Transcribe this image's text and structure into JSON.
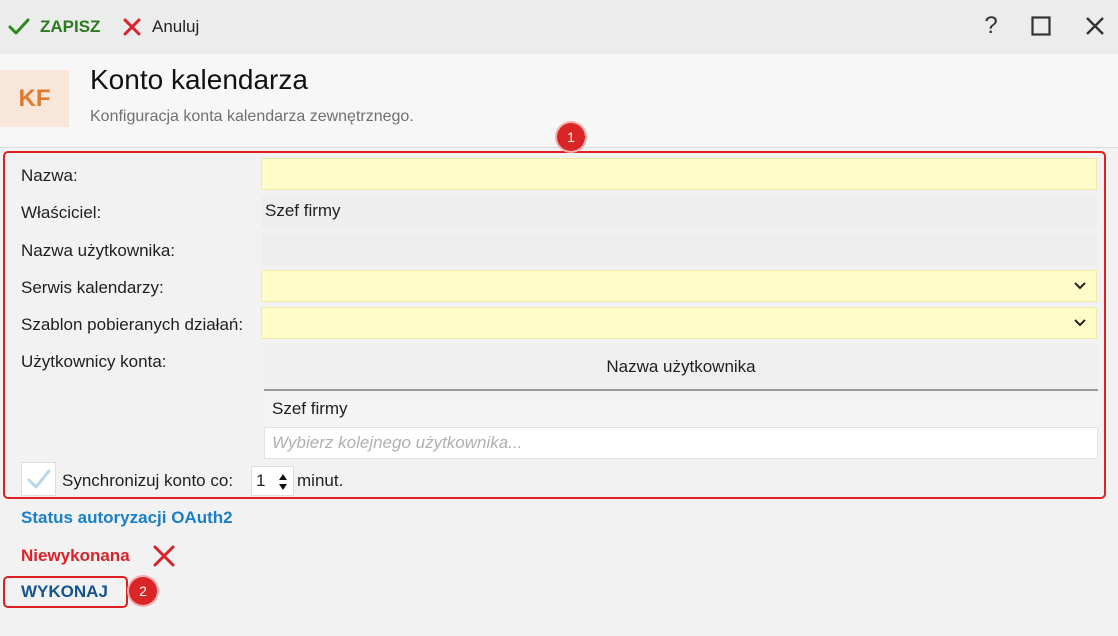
{
  "toolbar": {
    "save_label": "ZAPISZ",
    "cancel_label": "Anuluj",
    "help_label": "?"
  },
  "header": {
    "badge": "KF",
    "title": "Konto kalendarza",
    "subtitle": "Konfiguracja konta kalendarza zewnętrznego."
  },
  "markers": {
    "one": "1",
    "two": "2"
  },
  "form": {
    "name_label": "Nazwa:",
    "name_value": "",
    "owner_label": "Właściciel:",
    "owner_value": "Szef firmy",
    "username_label": "Nazwa użytkownika:",
    "username_value": "",
    "calendar_service_label": "Serwis kalendarzy:",
    "calendar_service_value": "",
    "template_label": "Szablon pobieranych działań:",
    "template_value": "",
    "account_users_label": "Użytkownicy konta:",
    "users_grid": {
      "column_header": "Nazwa użytkownika",
      "rows": [
        "Szef firmy"
      ],
      "add_placeholder": "Wybierz kolejnego użytkownika..."
    },
    "sync_label": "Synchronizuj konto co:",
    "sync_value": "1",
    "sync_unit": "minut."
  },
  "oauth": {
    "link_label": "Status autoryzacji OAuth2",
    "status_text": "Niewykonana",
    "execute_label": "WYKONAJ"
  },
  "colors": {
    "save_green": "#2a7a1e",
    "accent_orange": "#e07a2e",
    "required_yellow": "#fffcc8",
    "annotation_red": "#e02020",
    "link_blue": "#1a7fc8",
    "error_red": "#d9222a"
  },
  "icons": [
    "check-icon",
    "cross-icon",
    "help-icon",
    "maximize-icon",
    "close-icon",
    "chevron-down-icon",
    "checkbox-check-icon",
    "stepper-arrows-icon",
    "status-error-icon"
  ]
}
